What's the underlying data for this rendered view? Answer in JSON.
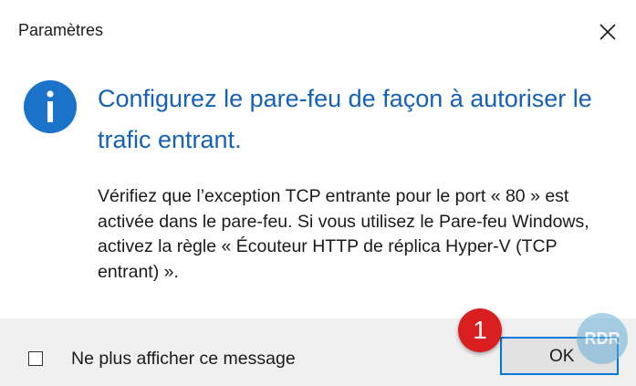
{
  "window": {
    "title": "Paramètres",
    "close_icon": "close-icon"
  },
  "content": {
    "info_icon": "info-icon",
    "heading": "Configurez le pare-feu de façon à autoriser le trafic entrant.",
    "message": "Vérifiez que l’exception TCP entrante pour le port « 80 » est activée dans le pare-feu. Si vous utilisez le Pare-feu Windows, activez la règle « Écouteur HTTP de réplica Hyper-V (TCP entrant) »."
  },
  "footer": {
    "checkbox_label": "Ne plus afficher ce message",
    "checkbox_checked": false,
    "ok_label": "OK"
  },
  "annotation": {
    "step_number": "1",
    "watermark": "RDR"
  },
  "colors": {
    "heading": "#1661b8",
    "info_icon": "#1a73c9",
    "footer_bg": "#f0f0f0",
    "ok_border": "#0078d7",
    "badge": "#d91f1f"
  }
}
